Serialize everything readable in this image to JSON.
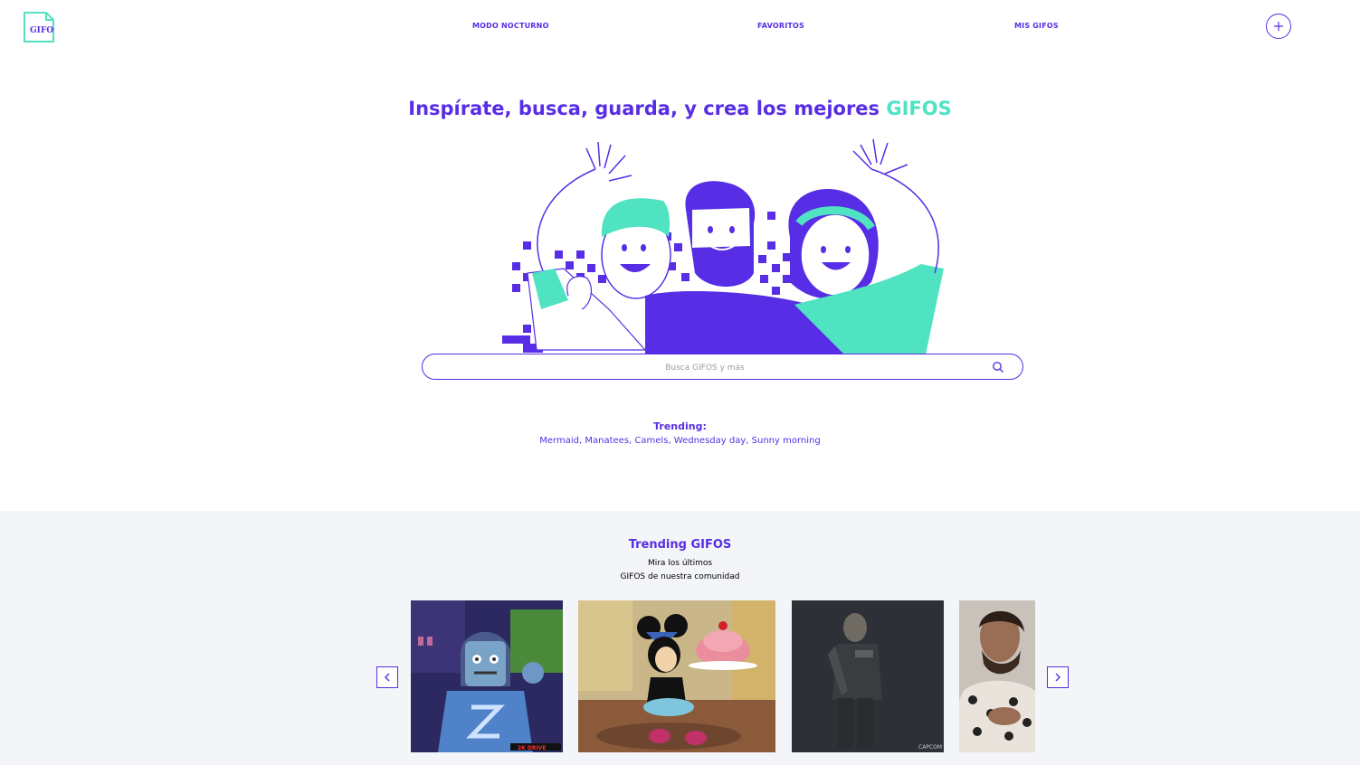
{
  "header": {
    "logo_text": "GIFOS",
    "nav": {
      "night_mode": "MODO NOCTURNO",
      "favorites": "FAVORITOS",
      "my_gifos": "MIS GIFOS"
    },
    "add_icon": "plus-icon"
  },
  "hero": {
    "title_main": "Inspírate, busca, guarda, y crea los mejores",
    "title_accent": "GIFOS",
    "illustration": "waving-friends-illustration"
  },
  "search": {
    "placeholder": "Busca GIFOS y más",
    "icon": "search-icon"
  },
  "trending": {
    "label": "Trending:",
    "terms": [
      "Mermaid",
      "Manatees",
      "Camels",
      "Wednesday day",
      "Sunny morning"
    ],
    "separator": ","
  },
  "trending_gifos": {
    "title": "Trending GIFOS",
    "subtitle_line1": "Mira los últimos",
    "subtitle_line2": "GIFOS de nuestra comunidad",
    "gifs": [
      {
        "alt": "lego zombie",
        "badge": "2K DRIVE"
      },
      {
        "alt": "minnie mouse with cake"
      },
      {
        "alt": "resident evil character",
        "badge": "CAPCOM"
      },
      {
        "alt": "man making heart"
      }
    ],
    "prev_icon": "chevron-left-icon",
    "next_icon": "chevron-right-icon"
  },
  "colors": {
    "primary": "#572EE5",
    "accent": "#50E3C2",
    "section_bg": "#F3F5F8"
  }
}
